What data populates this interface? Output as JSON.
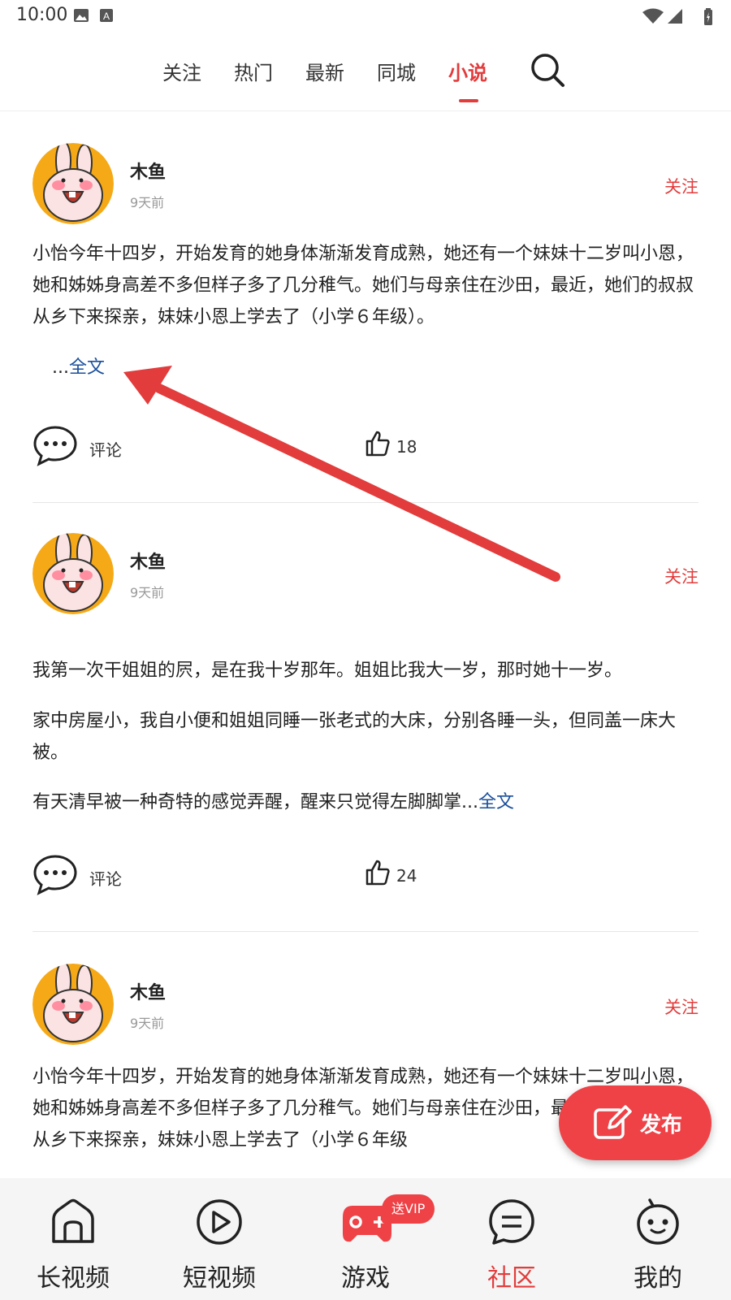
{
  "status_bar": {
    "time": "10:00"
  },
  "top_nav": {
    "tabs": [
      {
        "label": "关注"
      },
      {
        "label": "热门"
      },
      {
        "label": "最新"
      },
      {
        "label": "同城"
      },
      {
        "label": "小说",
        "active": true
      }
    ]
  },
  "posts": [
    {
      "username": "木鱼",
      "time": "9天前",
      "follow_label": "关注",
      "paragraphs": [
        "小怡今年十四岁，开始发育的她身体渐渐发育成熟，她还有一个妹妹十二岁叫小恩，她和姊姊身高差不多但样子多了几分稚气。她们与母亲住在沙田，最近，她们的叔叔从乡下来探亲，妹妹小恩上学去了（小学６年级）。"
      ],
      "ellipsis": "...",
      "more_label": "全文",
      "comment_label": "评论",
      "likes": "18"
    },
    {
      "username": "木鱼",
      "time": "9天前",
      "follow_label": "关注",
      "paragraphs": [
        "我第一次干姐姐的屄，是在我十岁那年。姐姐比我大一岁，那时她十一岁。",
        "家中房屋小，我自小便和姐姐同睡一张老式的大床，分别各睡一头，但同盖一床大被。",
        "有天清早被一种奇特的感觉弄醒，醒来只觉得左脚脚掌"
      ],
      "ellipsis": "...",
      "more_label": "全文",
      "comment_label": "评论",
      "likes": "24"
    },
    {
      "username": "木鱼",
      "time": "9天前",
      "follow_label": "关注",
      "paragraphs": [
        "小怡今年十四岁，开始发育的她身体渐渐发育成熟，她还有一个妹妹十二岁叫小恩，她和姊姊身高差不多但样子多了几分稚气。她们与母亲住在沙田，最近，她们的叔叔从乡下来探亲，妹妹小恩上学去了（小学６年级"
      ]
    }
  ],
  "fab": {
    "label": "发布",
    "icon": "edit-icon"
  },
  "bottom_nav": {
    "items": [
      {
        "label": "长视频",
        "icon": "home-icon"
      },
      {
        "label": "短视频",
        "icon": "play-icon"
      },
      {
        "label": "游戏",
        "icon": "gamepad-icon",
        "badge": "送VIP"
      },
      {
        "label": "社区",
        "icon": "chat-icon",
        "active": true
      },
      {
        "label": "我的",
        "icon": "robot-icon"
      }
    ]
  },
  "colors": {
    "accent": "#e23c3c",
    "link": "#1a4f9c",
    "annotation_arrow": "#e23c3c"
  }
}
